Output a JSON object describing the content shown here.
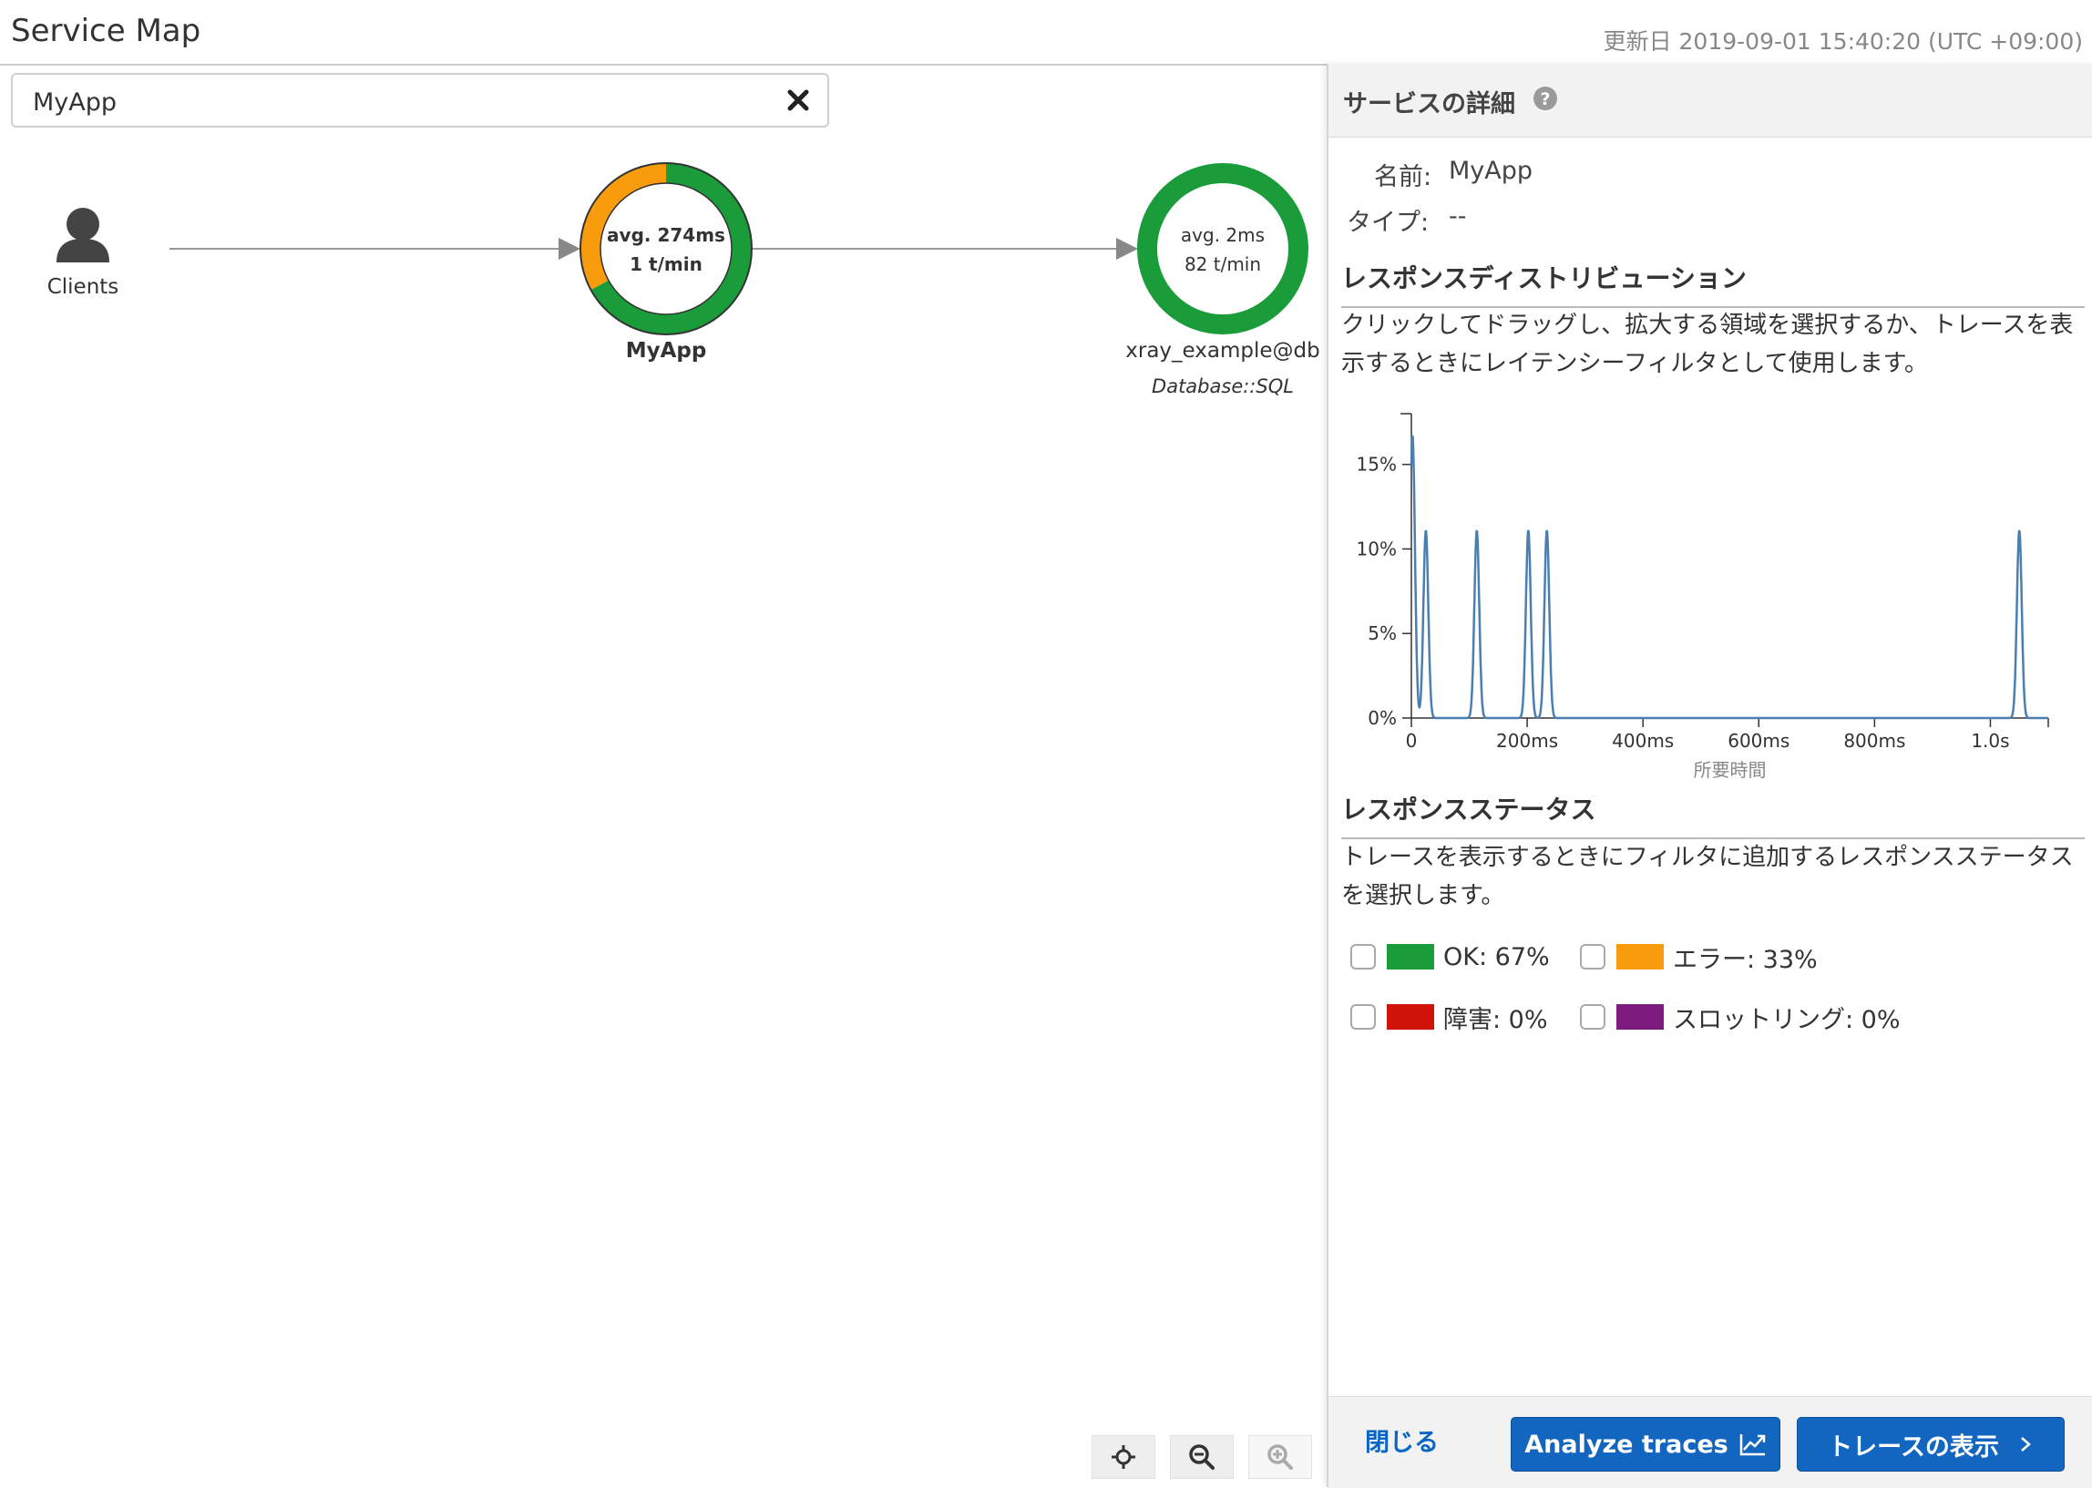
{
  "header": {
    "title": "Service Map",
    "updated": "更新日 2019-09-01 15:40:20 (UTC +09:00)"
  },
  "search": {
    "value": "MyApp",
    "clear_icon": "close-icon"
  },
  "map": {
    "clients": {
      "label": "Clients",
      "icon": "user-icon"
    },
    "myapp": {
      "name": "MyApp",
      "avg": "avg. 274ms",
      "rate": "1 t/min",
      "ok_fraction": 0.67,
      "error_fraction": 0.33
    },
    "db": {
      "name": "xray_example@db",
      "type": "Database::SQL",
      "avg": "avg. 2ms",
      "rate": "82 t/min",
      "ok_fraction": 1.0
    },
    "controls": [
      {
        "name": "recenter",
        "icon": "crosshair-icon"
      },
      {
        "name": "zoom-out",
        "icon": "zoom-out-icon"
      },
      {
        "name": "zoom-in",
        "icon": "zoom-in-icon"
      }
    ]
  },
  "panel": {
    "title": "サービスの詳細",
    "name_key": "名前:",
    "name_value": "MyApp",
    "type_key": "タイプ:",
    "type_value": "--",
    "response_dist": {
      "title": "レスポンスディストリビューション",
      "desc": "クリックしてドラッグし、拡大する領域を選択するか、トレースを表示するときにレイテンシーフィルタとして使用します。"
    },
    "response_status": {
      "title": "レスポンスステータス",
      "desc": "トレースを表示するときにフィルタに追加するレスポンスステータスを選択します。",
      "items": [
        {
          "label": "OK: 67%",
          "color": "#1a9c3a"
        },
        {
          "label": "エラー: 33%",
          "color": "#f89c0e"
        },
        {
          "label": "障害: 0%",
          "color": "#d0140c"
        },
        {
          "label": "スロットリング: 0%",
          "color": "#7d1a7d"
        }
      ]
    },
    "footer": {
      "close": "閉じる",
      "analyze": "Analyze traces",
      "view_traces": "トレースの表示"
    }
  },
  "colors": {
    "ok": "#1a9c3a",
    "error": "#f89c0e",
    "line": "#4a7fb0",
    "primary": "#1266c0"
  },
  "chart_data": {
    "type": "line",
    "title": "",
    "xlabel": "所要時間",
    "ylabel": "",
    "x_ticks": [
      "0",
      "200ms",
      "400ms",
      "600ms",
      "800ms",
      "1.0s"
    ],
    "y_ticks": [
      "0%",
      "5%",
      "10%",
      "15%"
    ],
    "xlim_ms": [
      0,
      1100
    ],
    "ylim_pct": [
      0,
      18
    ],
    "series": [
      {
        "peaks": [
          {
            "x_ms": 2,
            "y_pct": 16.7
          },
          {
            "x_ms": 25,
            "y_pct": 11.1
          },
          {
            "x_ms": 113,
            "y_pct": 11.1
          },
          {
            "x_ms": 202,
            "y_pct": 11.1
          },
          {
            "x_ms": 234,
            "y_pct": 11.1
          },
          {
            "x_ms": 1050,
            "y_pct": 11.1
          }
        ]
      }
    ]
  }
}
